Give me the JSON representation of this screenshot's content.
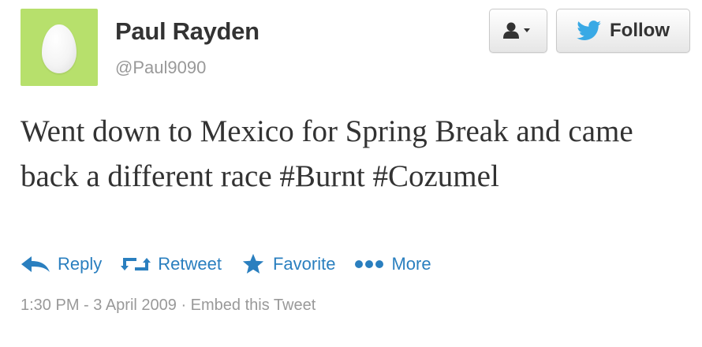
{
  "author": {
    "name": "Paul Rayden",
    "handle": "@Paul9090",
    "avatar_color": "#b7e06c"
  },
  "buttons": {
    "user_menu_icon": "person-dropdown-icon",
    "follow_label": "Follow",
    "follow_icon": "twitter-bird-icon"
  },
  "tweet": {
    "text": "Went down to Mexico for Spring Break and came back a different race #Burnt #Cozumel"
  },
  "actions": {
    "reply": "Reply",
    "retweet": "Retweet",
    "favorite": "Favorite",
    "more": "More"
  },
  "meta": {
    "timestamp": "1:30 PM - 3 April 2009",
    "separator": " · ",
    "embed": "Embed this Tweet"
  },
  "colors": {
    "link": "#2a7fbf",
    "twitter_blue": "#39a9e5",
    "text": "#333333",
    "muted": "#999999"
  }
}
